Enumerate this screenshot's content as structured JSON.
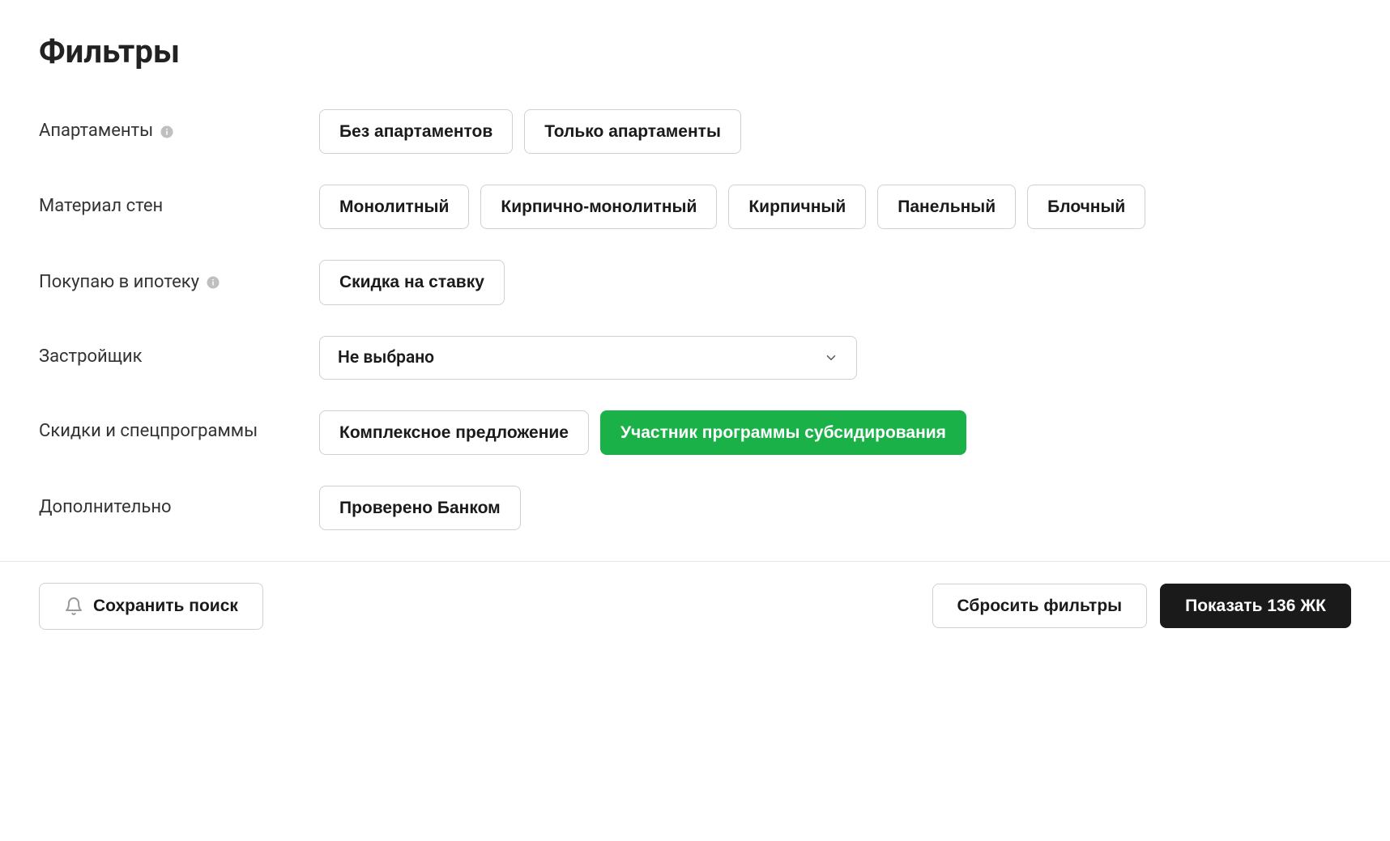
{
  "title": "Фильтры",
  "rows": {
    "apartments": {
      "label": "Апартаменты",
      "info": true,
      "options": [
        {
          "label": "Без апартаментов",
          "selected": false
        },
        {
          "label": "Только апартаменты",
          "selected": false
        }
      ]
    },
    "wall_material": {
      "label": "Материал стен",
      "info": false,
      "options": [
        {
          "label": "Монолитный",
          "selected": false
        },
        {
          "label": "Кирпично-монолитный",
          "selected": false
        },
        {
          "label": "Кирпичный",
          "selected": false
        },
        {
          "label": "Панельный",
          "selected": false
        },
        {
          "label": "Блочный",
          "selected": false
        }
      ]
    },
    "mortgage": {
      "label": "Покупаю в ипотеку",
      "info": true,
      "options": [
        {
          "label": "Скидка на ставку",
          "selected": false
        }
      ]
    },
    "developer": {
      "label": "Застройщик",
      "info": false,
      "select": {
        "value": "Не выбрано"
      }
    },
    "discounts": {
      "label": "Скидки и спецпрограммы",
      "info": false,
      "options": [
        {
          "label": "Комплексное предложение",
          "selected": false
        },
        {
          "label": "Участник программы субсидирования",
          "selected": true
        }
      ]
    },
    "extra": {
      "label": "Дополнительно",
      "info": false,
      "options": [
        {
          "label": "Проверено Банком",
          "selected": false
        }
      ]
    }
  },
  "footer": {
    "save": "Сохранить поиск",
    "reset": "Сбросить фильтры",
    "show": "Показать 136 ЖК"
  }
}
